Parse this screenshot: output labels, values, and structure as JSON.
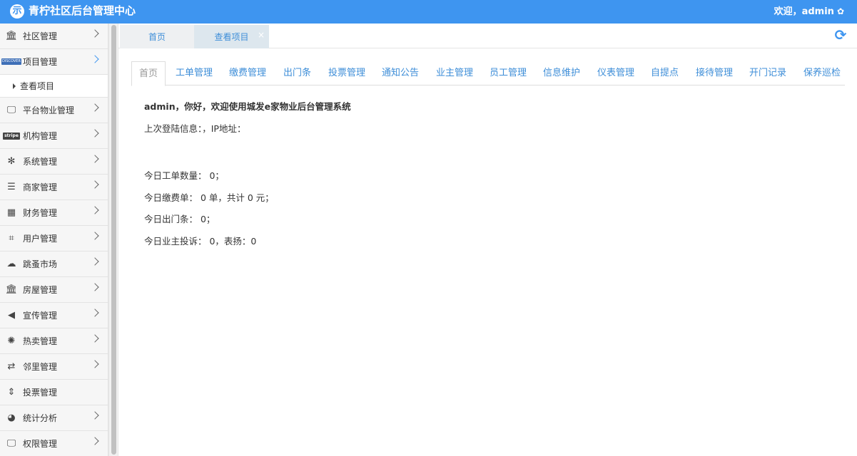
{
  "header": {
    "logo_glyph": "示",
    "title": "青柠社区后台管理中心",
    "welcome": "欢迎，admin",
    "settings_icon": "gear-icon",
    "accent": "#3e95f0"
  },
  "sidebar": {
    "items": [
      {
        "label": "社区管理",
        "icon": "bank-icon"
      },
      {
        "label": "项目管理",
        "icon": "discover-card-icon"
      },
      {
        "label": "平台物业管理",
        "icon": "desktop-icon"
      },
      {
        "label": "机构管理",
        "icon": "stripe-icon"
      },
      {
        "label": "系统管理",
        "icon": "yelp-icon"
      },
      {
        "label": "商家管理",
        "icon": "bars-icon"
      },
      {
        "label": "财务管理",
        "icon": "calculator-icon"
      },
      {
        "label": "用户管理",
        "icon": "crop-icon"
      },
      {
        "label": "跳蚤市场",
        "icon": "cloud-icon"
      },
      {
        "label": "房屋管理",
        "icon": "bank-icon"
      },
      {
        "label": "宣传管理",
        "icon": "volume-icon"
      },
      {
        "label": "热卖管理",
        "icon": "sun-icon"
      },
      {
        "label": "邻里管理",
        "icon": "retweet-icon"
      },
      {
        "label": "投票管理",
        "icon": "sort-icon"
      },
      {
        "label": "统计分析",
        "icon": "pie-chart-icon"
      },
      {
        "label": "权限管理",
        "icon": "desktop-icon"
      }
    ],
    "sub_item": "查看项目"
  },
  "page_tabs": {
    "home": "首页",
    "active": "查看项目",
    "close_glyph": "×",
    "refresh_glyph": "⟳"
  },
  "subnav": [
    "首页",
    "工单管理",
    "缴费管理",
    "出门条",
    "投票管理",
    "通知公告",
    "业主管理",
    "员工管理",
    "信息维护",
    "仪表管理",
    "自提点",
    "接待管理",
    "开门记录",
    "保养巡检"
  ],
  "main": {
    "greeting": "admin，你好，欢迎使用城发e家物业后台管理系统",
    "last_login": "上次登陆信息：，IP地址：",
    "today_orders": "今日工单数量： 0；",
    "today_payments": "今日缴费单： 0 单，共计 0 元；",
    "today_exit": "今日出门条： 0；",
    "today_complaints": "今日业主投诉： 0，表扬：0"
  }
}
